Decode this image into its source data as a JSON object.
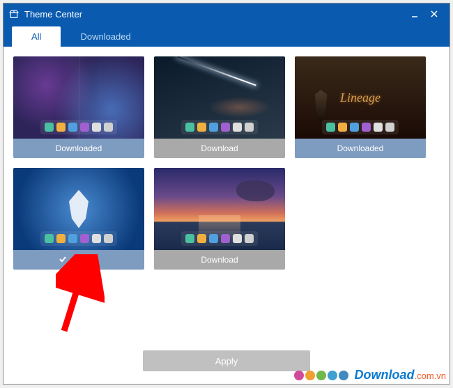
{
  "window": {
    "title": "Theme Center"
  },
  "tabs": {
    "all": "All",
    "downloaded": "Downloaded",
    "active": "all"
  },
  "themes": [
    {
      "id": "space",
      "status": "downloaded",
      "label": "Downloaded"
    },
    {
      "id": "comet",
      "status": "download",
      "label": "Download"
    },
    {
      "id": "lineage",
      "status": "downloaded",
      "label": "Downloaded",
      "logo_text": "Lineage"
    },
    {
      "id": "feather",
      "status": "applied",
      "label": "Applied"
    },
    {
      "id": "sunset",
      "status": "download",
      "label": "Download"
    }
  ],
  "footer": {
    "apply": "Apply"
  },
  "watermark": {
    "brand": "Download",
    "suffix": ".com.vn",
    "dot_colors": [
      "#d04a9a",
      "#f0a030",
      "#70b84a",
      "#40a0d0",
      "#408ac0"
    ]
  }
}
